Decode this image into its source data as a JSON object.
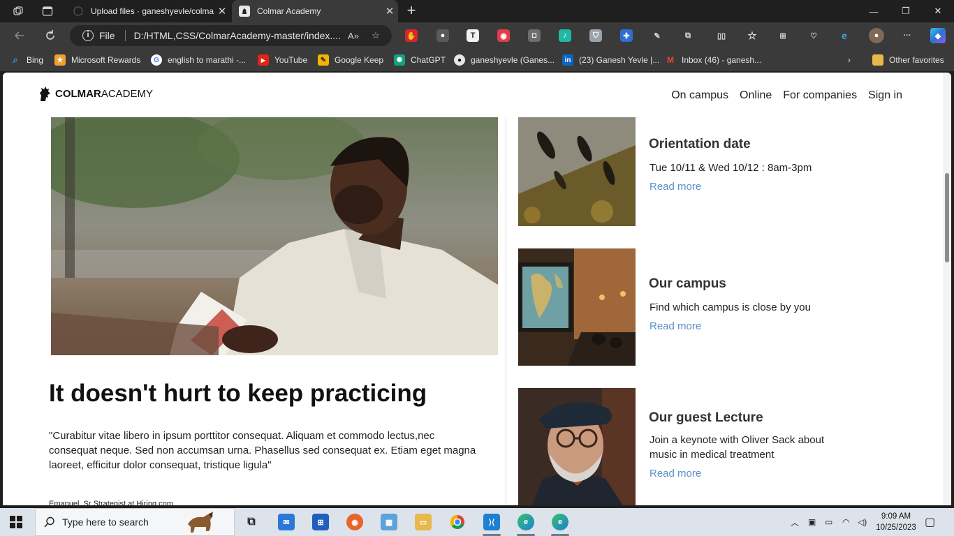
{
  "browser": {
    "tabs": [
      {
        "title": "Upload files · ganeshyevle/colmar",
        "active": false
      },
      {
        "title": "Colmar Academy",
        "active": true
      }
    ],
    "address": {
      "scheme": "File",
      "url": "D:/HTML,CSS/ColmarAcademy-master/index...."
    },
    "favorites": [
      {
        "label": "Bing",
        "icon": "search-icon",
        "color": "#3a96dd"
      },
      {
        "label": "Microsoft Rewards",
        "icon": "rewards-icon",
        "color": "#f0a030"
      },
      {
        "label": "english to marathi -...",
        "icon": "google-icon",
        "color": "#ffffff"
      },
      {
        "label": "YouTube",
        "icon": "youtube-icon",
        "color": "#e62117"
      },
      {
        "label": "Google Keep",
        "icon": "keep-icon",
        "color": "#f6b400"
      },
      {
        "label": "ChatGPT",
        "icon": "chatgpt-icon",
        "color": "#10a37f"
      },
      {
        "label": "ganeshyevle (Ganes...",
        "icon": "github-icon",
        "color": "#e6e6e6"
      },
      {
        "label": "(23) Ganesh Yevle |...",
        "icon": "linkedin-icon",
        "color": "#0a66c2"
      },
      {
        "label": "Inbox (46) - ganesh...",
        "icon": "gmail-icon",
        "color": "#ea4335"
      }
    ],
    "other_favorites": "Other favorites"
  },
  "site": {
    "logo": {
      "bold": "COLMAR",
      "regular": "ACADEMY"
    },
    "nav": [
      "On campus",
      "Online",
      "For companies",
      "Sign in"
    ],
    "feature": {
      "headline": "It doesn't hurt to keep practicing",
      "quote": "\"Curabitur vitae libero in ipsum porttitor consequat. Aliquam et commodo lectus,nec consequat neque. Sed non accumsan urna. Phasellus sed consequat ex. Etiam eget magna laoreet, efficitur dolor consequat, tristique ligula\"",
      "attribution": "Emanuel, Sr Strategist at Hiring.com"
    },
    "cards": [
      {
        "title": "Orientation date",
        "text": "Tue 10/11 & Wed 10/12 : 8am-3pm",
        "link": "Read more"
      },
      {
        "title": "Our campus",
        "text": "Find which campus is close by you",
        "link": "Read more"
      },
      {
        "title": "Our guest Lecture",
        "text": "Join a keynote with Oliver Sack about music in medical treatment",
        "link": "Read more"
      }
    ]
  },
  "taskbar": {
    "search_placeholder": "Type here to search",
    "time": "9:09 AM",
    "date": "10/25/2023"
  },
  "colors": {
    "link": "#5b8fc6",
    "browser_dark": "#1f1f1f",
    "browser_toolbar": "#3a3a3a"
  }
}
